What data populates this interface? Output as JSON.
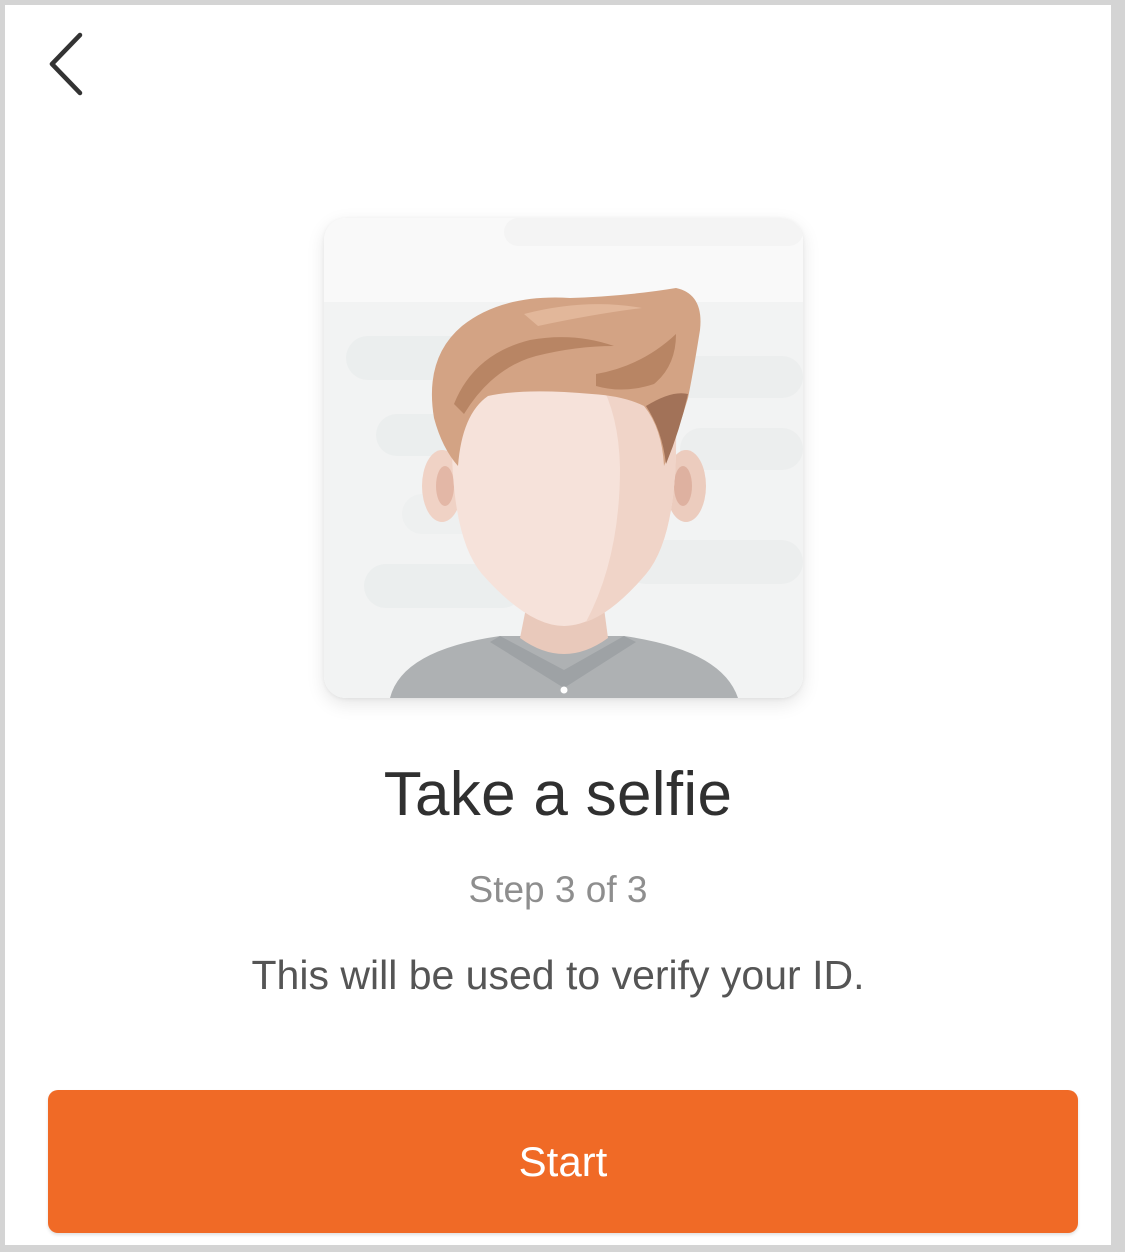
{
  "nav": {
    "back_icon": "chevron-left-icon"
  },
  "illustration": {
    "icon": "selfie-avatar-illustration"
  },
  "content": {
    "title": "Take a selfie",
    "step": "Step 3 of 3",
    "description": "This will be used to verify your ID."
  },
  "actions": {
    "start_label": "Start"
  },
  "colors": {
    "accent": "#f06a26",
    "title_text": "#303030",
    "step_text": "#8e8e8e",
    "description_text": "#555555",
    "background": "#ffffff",
    "frame": "#d4d4d4"
  }
}
